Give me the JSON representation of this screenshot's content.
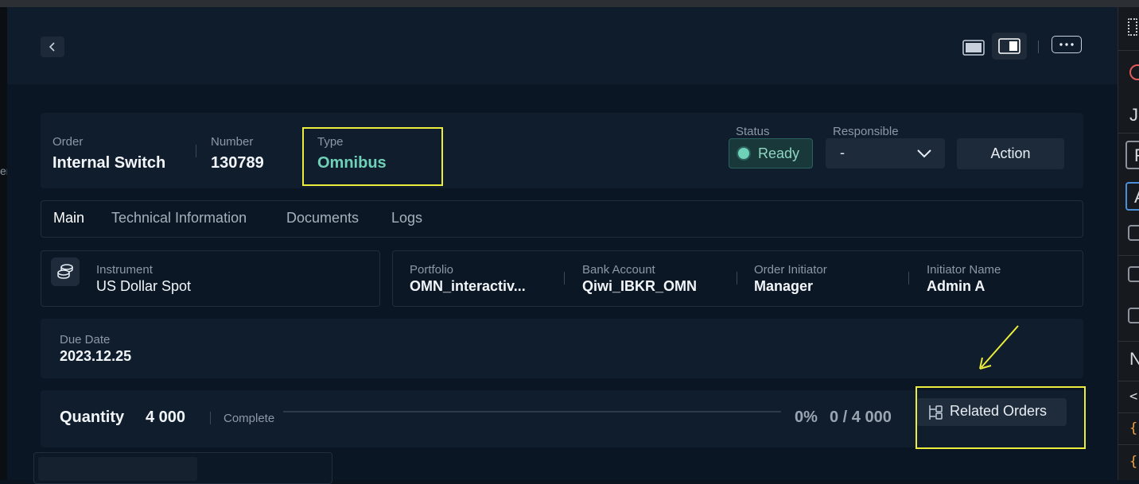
{
  "left_fragment": "er",
  "order": {
    "order_label": "Order",
    "order_value": "Internal Switch",
    "number_label": "Number",
    "number_value": "130789",
    "type_label": "Type",
    "type_value": "Omnibus",
    "status_label": "Status",
    "status_value": "Ready",
    "responsible_label": "Responsible",
    "responsible_value": "-",
    "action_label": "Action"
  },
  "tabs": [
    {
      "label": "Main",
      "active": true
    },
    {
      "label": "Technical Information",
      "active": false
    },
    {
      "label": "Documents",
      "active": false
    },
    {
      "label": "Logs",
      "active": false
    }
  ],
  "instrument": {
    "label": "Instrument",
    "value": "US Dollar Spot"
  },
  "details": [
    {
      "label": "Portfolio",
      "value": "OMN_interactiv..."
    },
    {
      "label": "Bank Account",
      "value": "Qiwi_IBKR_OMN"
    },
    {
      "label": "Order Initiator",
      "value": "Manager"
    },
    {
      "label": "Initiator Name",
      "value": "Admin A"
    }
  ],
  "due_date": {
    "label": "Due Date",
    "value": "2023.12.25"
  },
  "quantity": {
    "label": "Quantity",
    "value": "4 000",
    "complete_label": "Complete",
    "percent": "0%",
    "filled": "0 / 4 000",
    "progress_fraction": 0
  },
  "related_orders_label": "Related Orders",
  "right_panel": {
    "letters": [
      "J",
      "F",
      "A",
      "N"
    ],
    "codes": [
      "<",
      "{",
      "{"
    ]
  },
  "colors": {
    "accent_teal": "#6fd1b8",
    "highlight_yellow": "#ecec3c",
    "background": "#0a1623"
  }
}
